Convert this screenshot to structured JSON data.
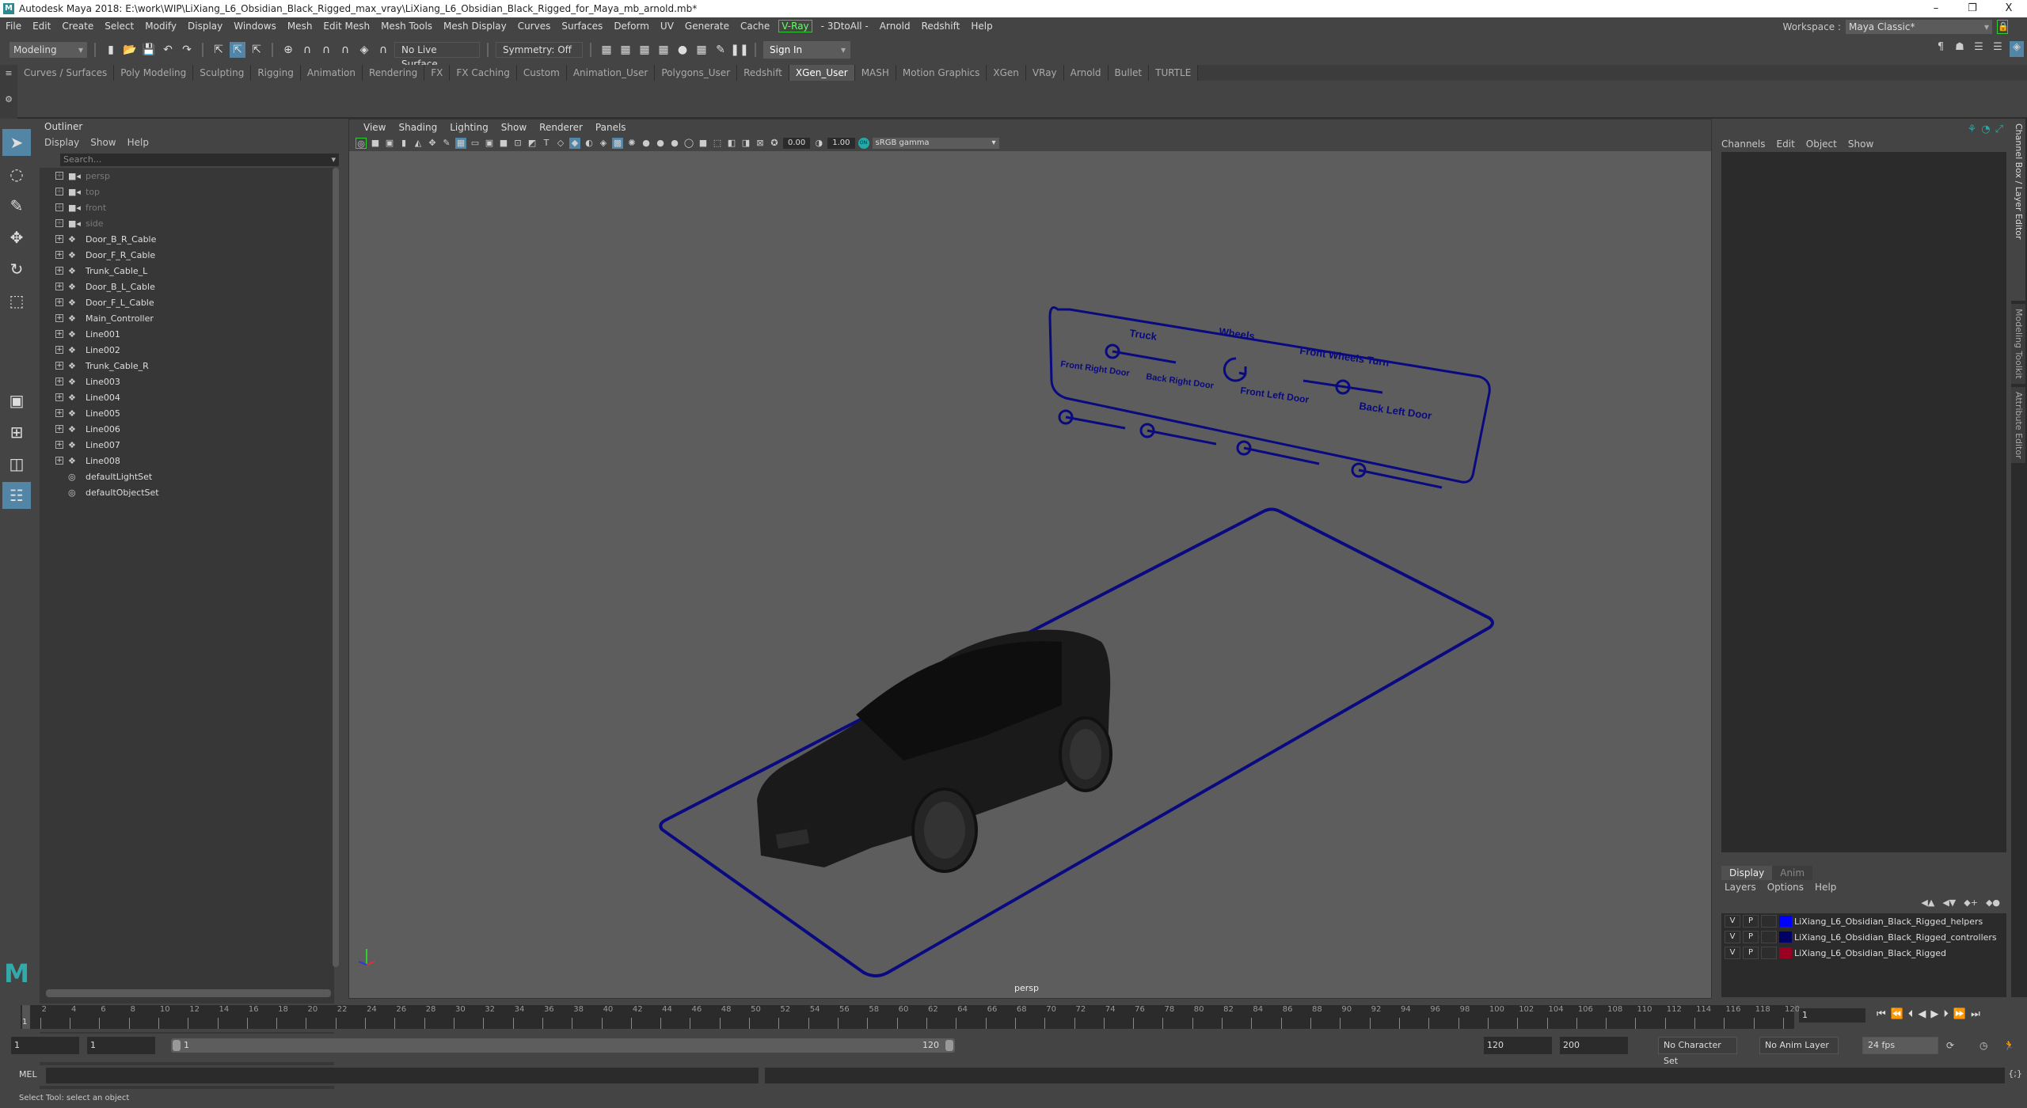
{
  "window": {
    "title": "Autodesk Maya 2018: E:\\work\\WIP\\LiXiang_L6_Obsidian_Black_Rigged_max_vray\\LiXiang_L6_Obsidian_Black_Rigged_for_Maya_mb_arnold.mb*",
    "minimize": "–",
    "maximize": "❐",
    "close": "X"
  },
  "menubar": [
    "File",
    "Edit",
    "Create",
    "Select",
    "Modify",
    "Display",
    "Windows",
    "Mesh",
    "Edit Mesh",
    "Mesh Tools",
    "Mesh Display",
    "Curves",
    "Surfaces",
    "Deform",
    "UV",
    "Generate",
    "Cache",
    "V-Ray",
    "- 3DtoAll -",
    "Arnold",
    "Redshift",
    "Help"
  ],
  "workspace": {
    "label": "Workspace :",
    "value": "Maya Classic*"
  },
  "toolbar": {
    "mode": "Modeling",
    "live_surface": "No Live Surface",
    "symmetry": "Symmetry: Off",
    "sign_in": "Sign In"
  },
  "shelf_tabs": [
    "Curves / Surfaces",
    "Poly Modeling",
    "Sculpting",
    "Rigging",
    "Animation",
    "Rendering",
    "FX",
    "FX Caching",
    "Custom",
    "Animation_User",
    "Polygons_User",
    "Redshift",
    "XGen_User",
    "MASH",
    "Motion Graphics",
    "XGen",
    "VRay",
    "Arnold",
    "Bullet",
    "TURTLE"
  ],
  "active_shelf": "XGen_User",
  "outliner": {
    "title": "Outliner",
    "menu": [
      "Display",
      "Show",
      "Help"
    ],
    "search_placeholder": "Search...",
    "items": [
      {
        "name": "persp",
        "type": "camera",
        "dim": true
      },
      {
        "name": "top",
        "type": "camera",
        "dim": true
      },
      {
        "name": "front",
        "type": "camera",
        "dim": true
      },
      {
        "name": "side",
        "type": "camera",
        "dim": true
      },
      {
        "name": "Door_B_R_Cable",
        "type": "transform"
      },
      {
        "name": "Door_F_R_Cable",
        "type": "transform"
      },
      {
        "name": "Trunk_Cable_L",
        "type": "transform"
      },
      {
        "name": "Door_B_L_Cable",
        "type": "transform"
      },
      {
        "name": "Door_F_L_Cable",
        "type": "transform"
      },
      {
        "name": "Main_Controller",
        "type": "transform"
      },
      {
        "name": "Line001",
        "type": "transform"
      },
      {
        "name": "Line002",
        "type": "transform"
      },
      {
        "name": "Trunk_Cable_R",
        "type": "transform"
      },
      {
        "name": "Line003",
        "type": "transform"
      },
      {
        "name": "Line004",
        "type": "transform"
      },
      {
        "name": "Line005",
        "type": "transform"
      },
      {
        "name": "Line006",
        "type": "transform"
      },
      {
        "name": "Line007",
        "type": "transform"
      },
      {
        "name": "Line008",
        "type": "transform"
      },
      {
        "name": "defaultLightSet",
        "type": "set"
      },
      {
        "name": "defaultObjectSet",
        "type": "set"
      }
    ]
  },
  "viewport": {
    "menu": [
      "View",
      "Shading",
      "Lighting",
      "Show",
      "Renderer",
      "Panels"
    ],
    "exposure": "0.00",
    "gamma": "1.00",
    "color_space": "sRGB gamma",
    "camera_label": "persp",
    "control_panel_labels": [
      "Truck",
      "Wheels",
      "Front Wheels Turn",
      "Front Right Door",
      "Back Right Door",
      "Front Left Door",
      "Back Left Door"
    ],
    "rig_color": "#0a0a80"
  },
  "channel_box": {
    "menu": [
      "Channels",
      "Edit",
      "Object",
      "Show"
    ]
  },
  "side_tabs": [
    "Channel Box / Layer Editor",
    "Modeling Toolkit",
    "Attribute Editor"
  ],
  "layer_editor": {
    "tabs": [
      "Display",
      "Anim"
    ],
    "menu": [
      "Layers",
      "Options",
      "Help"
    ],
    "layers": [
      {
        "v": "V",
        "p": "P",
        "color": "#0000ff",
        "name": "LiXiang_L6_Obsidian_Black_Rigged_helpers"
      },
      {
        "v": "V",
        "p": "P",
        "color": "#000066",
        "name": "LiXiang_L6_Obsidian_Black_Rigged_controllers"
      },
      {
        "v": "V",
        "p": "P",
        "color": "#990022",
        "name": "LiXiang_L6_Obsidian_Black_Rigged"
      }
    ]
  },
  "timeline": {
    "start": 1,
    "end": 120,
    "step": 2,
    "current_frame": "1",
    "range_start": "1",
    "playback_start": "1",
    "slider_start": "1",
    "slider_end": "120",
    "playback_end": "120",
    "range_end": "200",
    "character_set": "No Character Set",
    "anim_layer": "No Anim Layer",
    "fps": "24 fps"
  },
  "command_line": {
    "label": "MEL"
  },
  "status": "Select Tool: select an object"
}
